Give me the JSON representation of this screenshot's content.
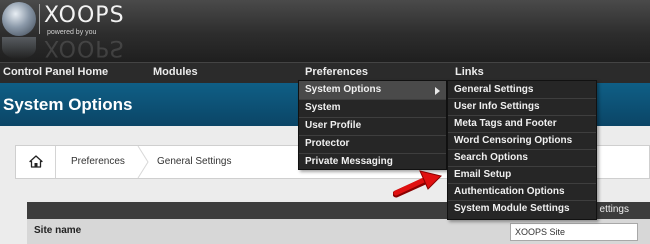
{
  "brand": {
    "name": "XOOPS",
    "tagline": "powered by you"
  },
  "menubar": [
    "Control Panel Home",
    "Modules",
    "Preferences",
    "Links"
  ],
  "page_title": "System Options",
  "breadcrumb": [
    "Preferences",
    "General Settings"
  ],
  "preferences_menu": [
    {
      "label": "System Options",
      "has_submenu": true,
      "highlighted": true
    },
    {
      "label": "System"
    },
    {
      "label": "User Profile"
    },
    {
      "label": "Protector"
    },
    {
      "label": "Private Messaging"
    }
  ],
  "system_options_submenu": [
    "General Settings",
    "User Info Settings",
    "Meta Tags and Footer",
    "Word Censoring Options",
    "Search Options",
    "Email Setup",
    "Authentication Options",
    "System Module Settings"
  ],
  "table": {
    "header_visible_text": "ettings",
    "rows": [
      {
        "label": "Site name",
        "value": "XOOPS Site"
      }
    ]
  },
  "annotation": {
    "target": "Email Setup",
    "color": "#e01010"
  }
}
